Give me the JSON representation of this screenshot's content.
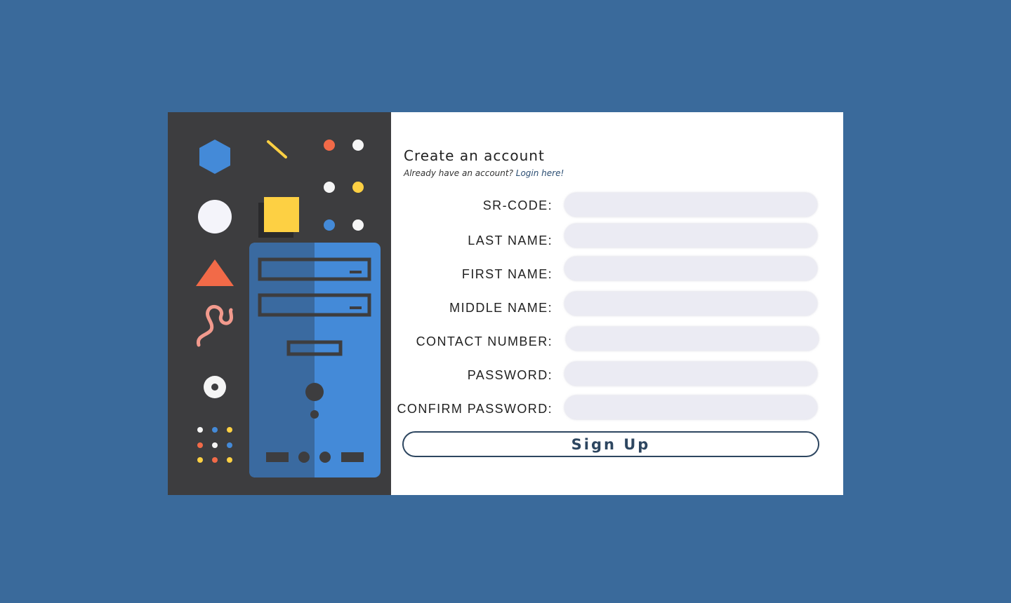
{
  "form": {
    "title": "Create an account",
    "subtitle_prefix": "Already have an account? ",
    "login_link": "Login here!",
    "fields": [
      {
        "label": "SR-CODE:",
        "value": "",
        "placeholder": ""
      },
      {
        "label": "LAST NAME:",
        "value": "",
        "placeholder": ""
      },
      {
        "label": "FIRST NAME:",
        "value": "",
        "placeholder": ""
      },
      {
        "label": "MIDDLE NAME:",
        "value": "",
        "placeholder": ""
      },
      {
        "label": "CONTACT NUMBER:",
        "value": "",
        "placeholder": ""
      },
      {
        "label": "PASSWORD:",
        "value": "",
        "placeholder": ""
      },
      {
        "label": "CONFIRM PASSWORD:",
        "value": "",
        "placeholder": ""
      }
    ],
    "submit_label": "Sign Up"
  },
  "colors": {
    "page_background": "#3a6a9b",
    "illustration_background": "#3d3d3f",
    "card_background": "#ffffff",
    "input_background": "#ebebf3",
    "button_border": "#2d4660",
    "accent_blue": "#448ad8",
    "accent_yellow": "#fdd043",
    "accent_orange": "#f26a48",
    "accent_pink": "#f29a8d"
  },
  "illustration": {
    "icons": [
      "hexagon-icon",
      "line-icon",
      "dot-grid-icon",
      "circle-icon",
      "square-icon",
      "triangle-icon",
      "squiggle-icon",
      "disc-icon",
      "computer-tower-icon"
    ]
  }
}
